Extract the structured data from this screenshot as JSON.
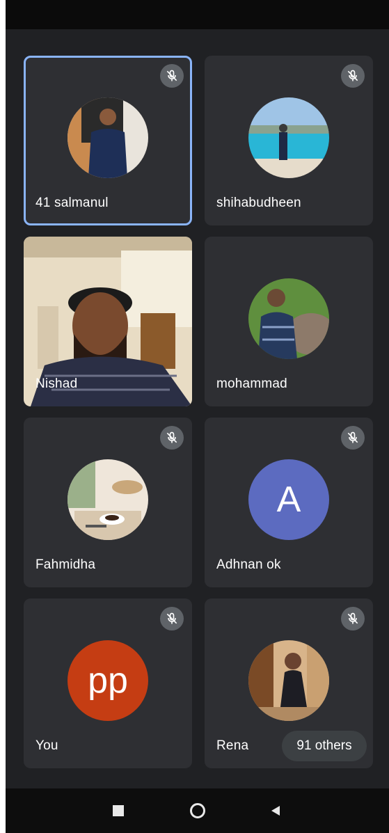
{
  "participants": [
    {
      "name": "41 salmanul",
      "muted": true,
      "active": true,
      "avatar": "photo"
    },
    {
      "name": "shihabudheen",
      "muted": true,
      "active": false,
      "avatar": "photo"
    },
    {
      "name": "Nishad",
      "muted": false,
      "active": false,
      "avatar": "video"
    },
    {
      "name": "mohammad",
      "muted": false,
      "active": false,
      "avatar": "photo"
    },
    {
      "name": "Fahmidha",
      "muted": true,
      "active": false,
      "avatar": "photo"
    },
    {
      "name": "Adhnan ok",
      "muted": true,
      "active": false,
      "avatar": "letter",
      "initial": "A",
      "color": "#5c6bc0"
    },
    {
      "name": "You",
      "muted": true,
      "active": false,
      "avatar": "letter",
      "initial": "pp",
      "color": "#c53d13"
    },
    {
      "name": "Rena",
      "muted": true,
      "active": false,
      "avatar": "photo"
    }
  ],
  "others_chip": {
    "label": "91 others"
  },
  "icons": {
    "mic_off": "mic-off-icon",
    "nav_recents": "square-icon",
    "nav_home": "circle-icon",
    "nav_back": "triangle-back-icon"
  },
  "colors": {
    "background": "#202124",
    "tile": "#2e2f33",
    "active_border": "#8ab4f8",
    "mic_badge": "#5f6368"
  }
}
